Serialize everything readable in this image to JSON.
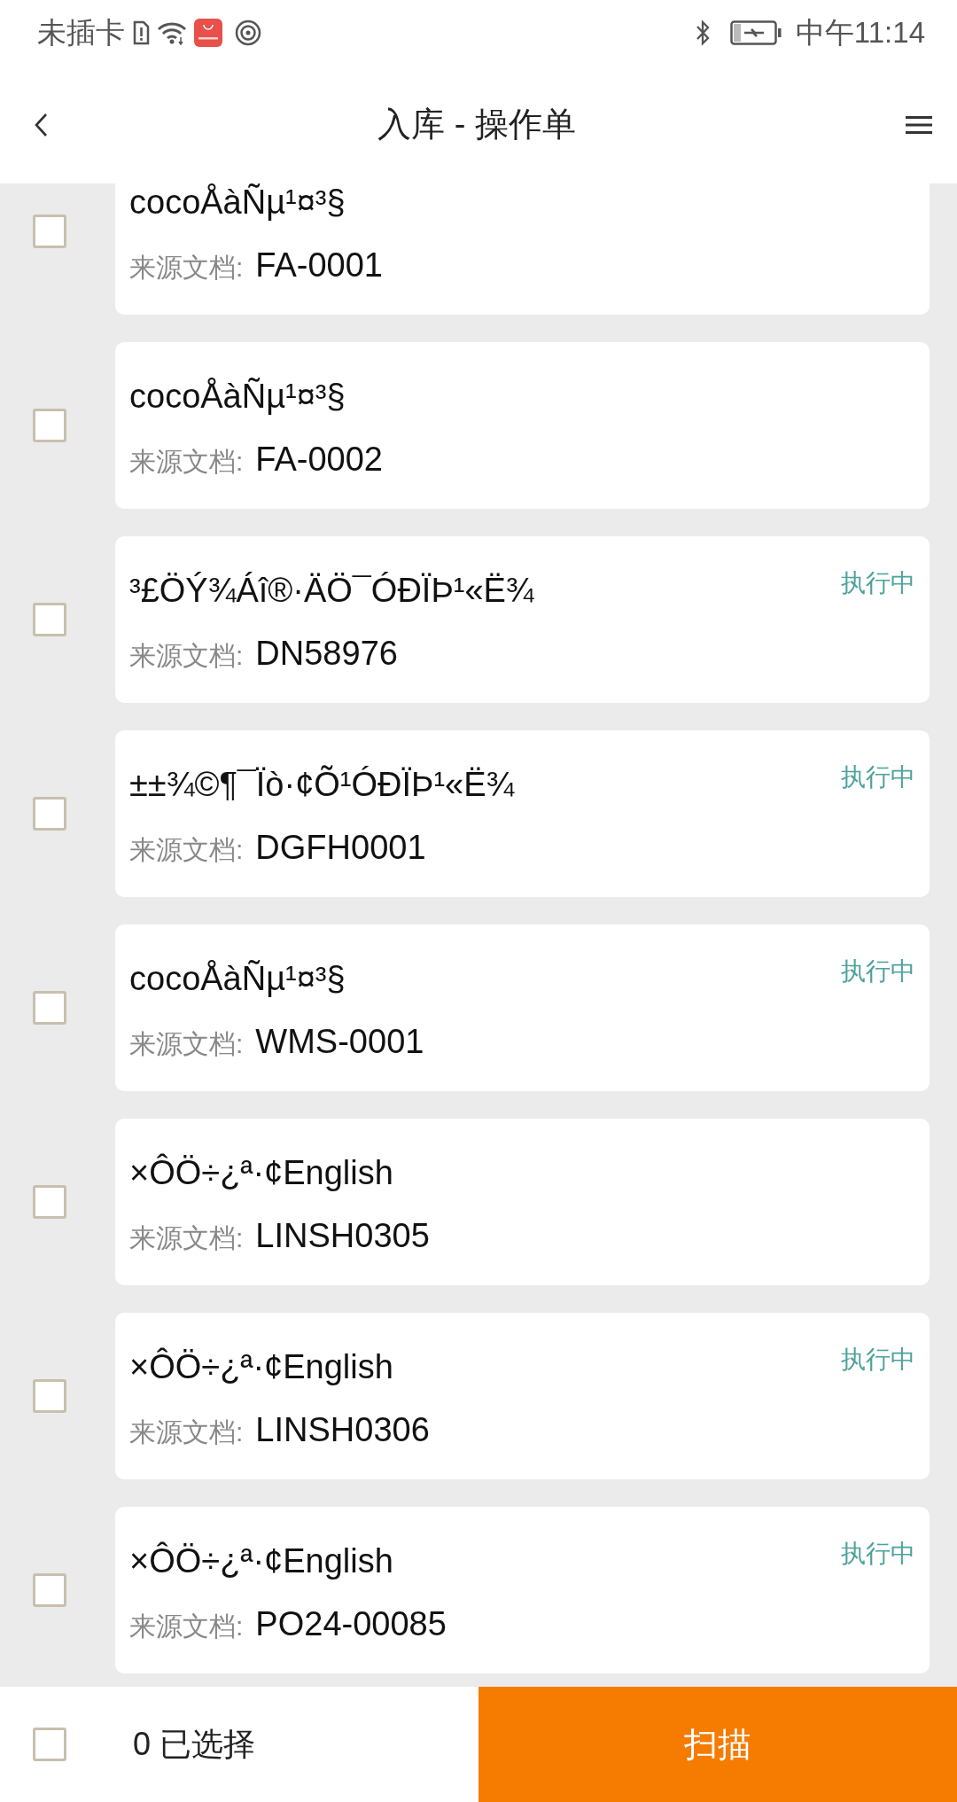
{
  "status_bar": {
    "carrier": "未插卡",
    "time": "中午11:14"
  },
  "header": {
    "title": "入库 - 操作单"
  },
  "orders": [
    {
      "title": "cocoÅàÑµ¹¤³§",
      "source_label": "来源文档:",
      "source": "FA-0001",
      "checked": false
    },
    {
      "title": "cocoÅàÑµ¹¤³§",
      "source_label": "来源文档:",
      "source": "FA-0002",
      "checked": false
    },
    {
      "title": "³£ÖÝ¾Áî®·ÄÖ¯ÓÐÏÞ¹«Ë¾",
      "source_label": "来源文档:",
      "source": "DN58976",
      "status": "执行中",
      "checked": false
    },
    {
      "title": "±±¾©¶¯Ïò·¢Õ¹ÓÐÏÞ¹«Ë¾",
      "source_label": "来源文档:",
      "source": "DGFH0001",
      "status": "执行中",
      "checked": false
    },
    {
      "title": "cocoÅàÑµ¹¤³§",
      "source_label": "来源文档:",
      "source": "WMS-0001",
      "status": "执行中",
      "checked": false
    },
    {
      "title": "×ÔÖ÷¿ª·¢English",
      "source_label": "来源文档:",
      "source": "LINSH0305",
      "checked": false
    },
    {
      "title": "×ÔÖ÷¿ª·¢English",
      "source_label": "来源文档:",
      "source": "LINSH0306",
      "status": "执行中",
      "checked": false
    },
    {
      "title": "×ÔÖ÷¿ª·¢English",
      "source_label": "来源文档:",
      "source": "PO24-00085",
      "status": "执行中",
      "checked": false
    }
  ],
  "footer": {
    "select_all_checked": false,
    "selected_count": "0 已选择",
    "scan_button": "扫描"
  }
}
